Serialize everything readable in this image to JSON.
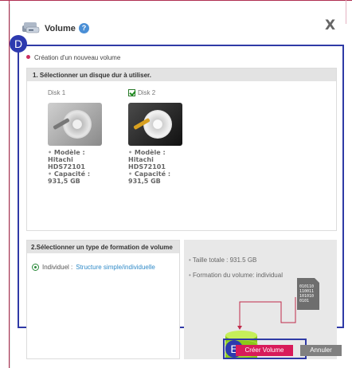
{
  "dialog": {
    "title": "Volume",
    "help_symbol": "?",
    "close_label": "X"
  },
  "annotations": {
    "d": "D",
    "e": "E"
  },
  "section": {
    "title": "Création d'un nouveau volume"
  },
  "step1": {
    "title": "1. Sélectionner un disque dur à utiliser.",
    "disks": [
      {
        "label": "Disk 1",
        "checked": false,
        "model_label": "Modèle :",
        "model_line1": "Hitachi",
        "model_line2": "HDS72101",
        "capacity_label": "Capacité :",
        "capacity": "931,5 GB",
        "selected": false
      },
      {
        "label": "Disk 2",
        "checked": true,
        "model_label": "Modèle :",
        "model_line1": "Hitachi",
        "model_line2": "HDS72101",
        "capacity_label": "Capacité :",
        "capacity": "931,5 GB",
        "selected": true
      }
    ]
  },
  "step2": {
    "title": "2.Sélectionner un type de formation de volume",
    "option_prefix": "Individuel :",
    "option_link": "Structure simple/individuelle"
  },
  "summary": {
    "total_size": "Taille totale : 931.5 GB",
    "formation": "Formation du volume: individual",
    "binary_lines": [
      "010110",
      "110011",
      "101010",
      "0101"
    ]
  },
  "buttons": {
    "create": "Créer Volume",
    "cancel": "Annuler"
  },
  "colors": {
    "accent": "#d81b5a",
    "annotation": "#2f3aa6",
    "link": "#2f8ac8"
  }
}
